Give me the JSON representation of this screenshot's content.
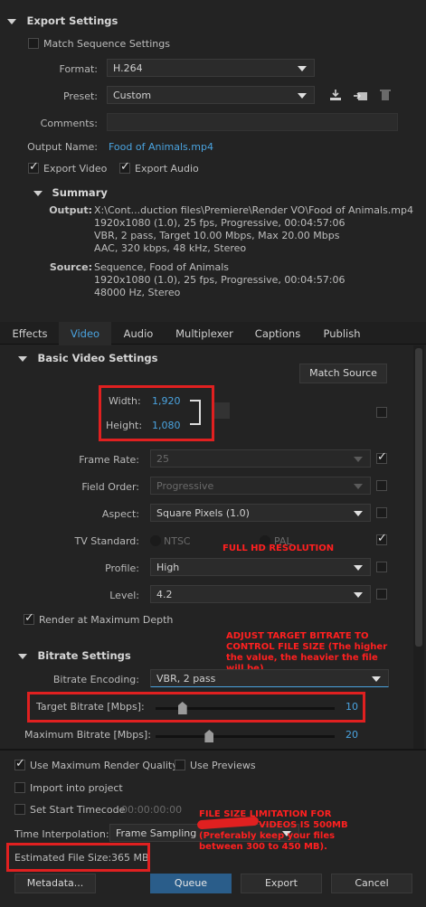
{
  "export_settings": {
    "title": "Export Settings",
    "match_sequence": "Match Sequence Settings",
    "format_label": "Format:",
    "format_value": "H.264",
    "preset_label": "Preset:",
    "preset_value": "Custom",
    "comments_label": "Comments:",
    "output_name_label": "Output Name:",
    "output_name_value": "Food of Animals.mp4",
    "export_video": "Export Video",
    "export_audio": "Export Audio"
  },
  "summary": {
    "title": "Summary",
    "output_label": "Output:",
    "output_lines": [
      "X:\\Cont...duction files\\Premiere\\Render VO\\Food of Animals.mp4",
      "1920x1080 (1.0), 25 fps, Progressive, 00:04:57:06",
      "VBR, 2 pass, Target 10.00 Mbps, Max 20.00 Mbps",
      "AAC, 320 kbps, 48 kHz, Stereo"
    ],
    "source_label": "Source:",
    "source_lines": [
      "Sequence, Food of Animals",
      "1920x1080 (1.0), 25 fps, Progressive, 00:04:57:06",
      "48000 Hz, Stereo"
    ]
  },
  "tabs": [
    "Effects",
    "Video",
    "Audio",
    "Multiplexer",
    "Captions",
    "Publish"
  ],
  "basic_video": {
    "title": "Basic Video Settings",
    "match_source": "Match Source",
    "width_label": "Width:",
    "width_value": "1,920",
    "height_label": "Height:",
    "height_value": "1,080",
    "frame_rate_label": "Frame Rate:",
    "frame_rate_value": "25",
    "field_order_label": "Field Order:",
    "field_order_value": "Progressive",
    "aspect_label": "Aspect:",
    "aspect_value": "Square Pixels (1.0)",
    "tv_standard_label": "TV Standard:",
    "ntsc": "NTSC",
    "pal": "PAL",
    "profile_label": "Profile:",
    "profile_value": "High",
    "level_label": "Level:",
    "level_value": "4.2",
    "render_max_depth": "Render at Maximum Depth"
  },
  "bitrate": {
    "title": "Bitrate Settings",
    "encoding_label": "Bitrate Encoding:",
    "encoding_value": "VBR, 2 pass",
    "target_label": "Target Bitrate [Mbps]:",
    "target_value": "10",
    "target_fraction": 0.15,
    "max_label": "Maximum Bitrate [Mbps]:",
    "max_value": "20",
    "max_fraction": 0.3
  },
  "bottom": {
    "use_max_render": "Use Maximum Render Quality",
    "use_previews": "Use Previews",
    "import_project": "Import into project",
    "set_start_timecode": "Set Start Timecode",
    "timecode_value": "00:00:00:00",
    "time_interp_label": "Time Interpolation:",
    "time_interp_value": "Frame Sampling",
    "est_label": "Estimated File Size:",
    "est_value": "365 MB",
    "metadata": "Metadata...",
    "queue": "Queue",
    "export": "Export",
    "cancel": "Cancel"
  },
  "annotations": {
    "full_hd": "FULL HD RESOLUTION",
    "bitrate_note": "ADJUST TARGET BITRATE TO CONTROL FILE SIZE (The higher the value, the heavier the file will be).",
    "file_size_note_1": "FILE SIZE LIMITATION FOR",
    "file_size_note_2": "VIDEOS IS 500MB",
    "file_size_note_3": "(Preferably keep your files between 300 to 450 MB)."
  },
  "colors": {
    "accent": "#4aa3df",
    "annotation": "#e02020",
    "queue_button": "#2a5d8a"
  }
}
